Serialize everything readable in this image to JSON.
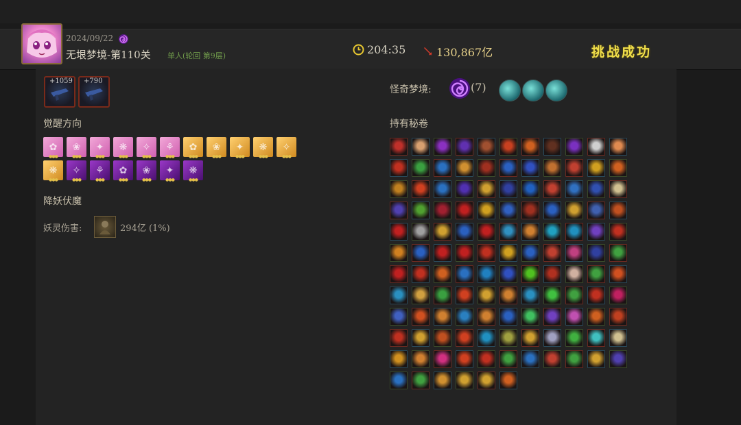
{
  "header": {
    "date": "2024/09/22",
    "title": "无垠梦境-第110关",
    "subtitle": "单人(轮回  第9层)",
    "time": "204:35",
    "damage": "130,867亿",
    "result": "挑战成功"
  },
  "equipment": [
    {
      "value": "+1059"
    },
    {
      "value": "+790"
    }
  ],
  "awaken": {
    "label": "觉醒方向",
    "rows": [
      [
        "pink",
        "pink",
        "pink",
        "pink",
        "pink",
        "pink",
        "gold",
        "gold",
        "gold",
        "gold",
        "gold"
      ],
      [
        "gold",
        "purple",
        "purple",
        "purple",
        "purple",
        "purple",
        "purple"
      ]
    ]
  },
  "demon": {
    "section_label": "降妖伏魔",
    "damage_label": "妖灵伤害:",
    "damage_value": "294亿  (1%)"
  },
  "strange": {
    "label": "怪奇梦境:",
    "count": "(7)"
  },
  "scrolls": {
    "label": "持有秘卷",
    "rows": [
      [
        "#c0302a",
        "#d8a070",
        "#8a30c0",
        "#6030b0",
        "#a05030",
        "#c84020",
        "#d06020",
        "#603020",
        "#7a30c0",
        "#d0d0d0",
        "#e08a50"
      ],
      [
        "#c03020",
        "#3aa040",
        "#2a70c0",
        "#d09030",
        "#a03020",
        "#2a60c0",
        "#3050c0",
        "#c07030",
        "#c04030",
        "#d0a020",
        "#d06020"
      ],
      [
        "#c08020",
        "#d04020",
        "#2a70c0",
        "#5030b0",
        "#d0a030",
        "#3040a0",
        "#2060c0",
        "#c04030",
        "#3070c0",
        "#3050b0",
        "#d0c090"
      ],
      [
        "#5040b0",
        "#50a030",
        "#a02030",
        "#c02020",
        "#d0a020",
        "#3060c0",
        "#a03020",
        "#2a60c0",
        "#d0a030",
        "#4060b0",
        "#c05020"
      ],
      [
        "#c02020",
        "#a0a0a0",
        "#d0a030",
        "#2a60c0",
        "#c02020",
        "#3090c0",
        "#d08030",
        "#20a0c0",
        "#2090c0",
        "#7040c0",
        "#c03020"
      ],
      [
        "#d08020",
        "#2a60c0",
        "#c02020",
        "#c02020",
        "#c03020",
        "#d0a020",
        "#2a60c0",
        "#c04030",
        "#c04080",
        "#3040a0",
        "#40a040"
      ],
      [
        "#c02020",
        "#c03020",
        "#d06020",
        "#2a70c0",
        "#2080c0",
        "#3050c0",
        "#50c020",
        "#b03020",
        "#d0b0a0",
        "#40a040",
        "#d05020"
      ],
      [
        "#2a90c0",
        "#d0a040",
        "#3aa040",
        "#d04020",
        "#d0a030",
        "#d08030",
        "#2a90c0",
        "#40c040",
        "#40a040",
        "#c03020",
        "#c02060"
      ],
      [
        "#4060c0",
        "#d05020",
        "#d08030",
        "#2a80c0",
        "#d08030",
        "#2a60c0",
        "#40c060",
        "#7040c0",
        "#c050b0",
        "#d06020",
        "#c04020"
      ],
      [
        "#c03020",
        "#d0a030",
        "#c05020",
        "#d04020",
        "#2090c0",
        "#a0a040",
        "#d0a030",
        "#a0a0c0",
        "#40b040",
        "#40c0c0",
        "#d0c090"
      ],
      [
        "#d09020",
        "#d08030",
        "#d03080",
        "#d04020",
        "#c03020",
        "#40a040",
        "#2a70c0",
        "#c04030",
        "#40a040",
        "#d0a030",
        "#5040b0"
      ],
      [
        "#2a70c0",
        "#40a040",
        "#d09030",
        "#d0a030",
        "#d0a030",
        "#d06020"
      ]
    ]
  }
}
